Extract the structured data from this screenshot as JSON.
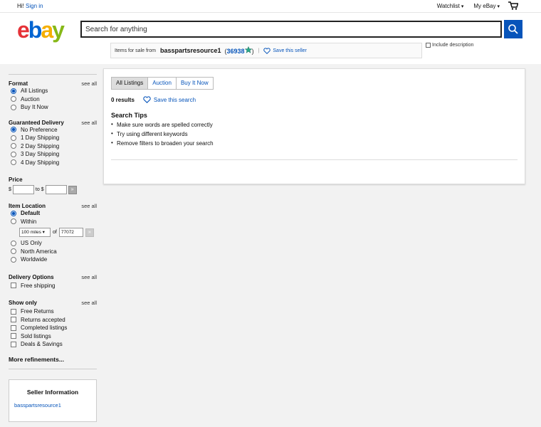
{
  "topbar": {
    "greeting": "Hi!",
    "signin": "Sign in",
    "watchlist": "Watchlist",
    "myebay": "My eBay"
  },
  "header": {
    "logo": {
      "e": "e",
      "b": "b",
      "a": "a",
      "y": "y"
    },
    "search_placeholder": "Search for anything",
    "include_description": "Include description"
  },
  "seller_bar": {
    "prefix": "Items for sale from",
    "seller_name": "basspartsresource1",
    "score": "36938",
    "save_seller": "Save this seller"
  },
  "sidebar": {
    "format": {
      "title": "Format",
      "see_all": "see all",
      "options": [
        {
          "label": "All Listings",
          "selected": true
        },
        {
          "label": "Auction",
          "selected": false
        },
        {
          "label": "Buy It Now",
          "selected": false
        }
      ]
    },
    "delivery": {
      "title": "Guaranteed Delivery",
      "see_all": "see all",
      "options": [
        {
          "label": "No Preference",
          "selected": true
        },
        {
          "label": "1 Day Shipping",
          "selected": false
        },
        {
          "label": "2 Day Shipping",
          "selected": false
        },
        {
          "label": "3 Day Shipping",
          "selected": false
        },
        {
          "label": "4 Day Shipping",
          "selected": false
        }
      ]
    },
    "price": {
      "title": "Price",
      "currency": "$",
      "to": "to $",
      "go": "»"
    },
    "location": {
      "title": "Item Location",
      "see_all": "see all",
      "default": "Default",
      "within": "Within",
      "miles": "100 miles",
      "of": "of",
      "zip": "77072",
      "go": "»",
      "other_options": [
        {
          "label": "US Only"
        },
        {
          "label": "North America"
        },
        {
          "label": "Worldwide"
        }
      ]
    },
    "delivery_options": {
      "title": "Delivery Options",
      "see_all": "see all",
      "options": [
        {
          "label": "Free shipping"
        }
      ]
    },
    "show_only": {
      "title": "Show only",
      "see_all": "see all",
      "options": [
        {
          "label": "Free Returns"
        },
        {
          "label": "Returns accepted"
        },
        {
          "label": "Completed listings"
        },
        {
          "label": "Sold listings"
        },
        {
          "label": "Deals & Savings"
        }
      ]
    },
    "more_refinements": "More refinements...",
    "seller_info": {
      "title": "Seller Information",
      "name": "basspartsresource1"
    }
  },
  "results": {
    "tabs": [
      "All Listings",
      "Auction",
      "Buy It Now"
    ],
    "count": "0 results",
    "save_search": "Save this search",
    "tips_title": "Search Tips",
    "tips": [
      "Make sure words are spelled correctly",
      "Try using different keywords",
      "Remove filters to broaden your search"
    ]
  },
  "colors": {
    "link": "#0654ba",
    "search_button": "#0654ba"
  }
}
